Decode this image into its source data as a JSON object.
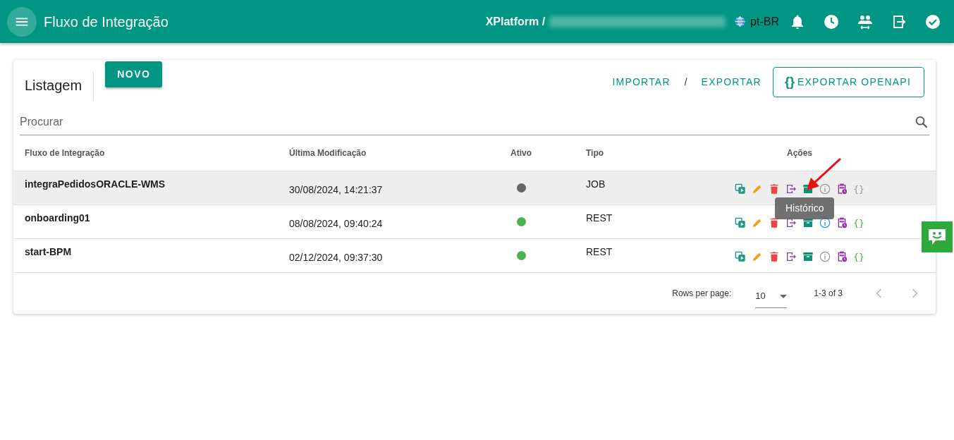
{
  "app_bar": {
    "title": "Fluxo de Integração",
    "platform": "XPlatform /",
    "language": "pt-BR"
  },
  "card": {
    "title": "Listagem",
    "new_button": "NOVO",
    "import_link": "IMPORTAR",
    "separator": "/",
    "export_link": "EXPORTAR",
    "openapi_button": {
      "icon": "{}",
      "label": "EXPORTAR OPENAPI"
    }
  },
  "search": {
    "placeholder": "Procurar"
  },
  "table": {
    "columns": [
      "Fluxo de Integração",
      "Última Modificação",
      "Ativo",
      "Tipo",
      "Ações"
    ],
    "rows": [
      {
        "name": "integraPedidosORACLE-WMS",
        "modified": "30/08/2024, 14:21:37",
        "active": false,
        "type": "JOB",
        "selected": true,
        "info_active": false,
        "openapi_active": false,
        "openapi_icon": "{}"
      },
      {
        "name": "onboarding01",
        "modified": "08/08/2024, 09:40:24",
        "active": true,
        "type": "REST",
        "selected": false,
        "info_active": true,
        "openapi_active": true,
        "openapi_icon": "{}"
      },
      {
        "name": "start-BPM",
        "modified": "02/12/2024, 09:37:30",
        "active": true,
        "type": "REST",
        "selected": false,
        "info_active": false,
        "openapi_active": true,
        "openapi_icon": "{}"
      }
    ]
  },
  "tooltip": "Histórico",
  "pagination": {
    "rows_label": "Rows per page:",
    "rows_value": "10",
    "range": "1-3 of 3",
    "prev_disabled": true,
    "next_disabled": true
  }
}
